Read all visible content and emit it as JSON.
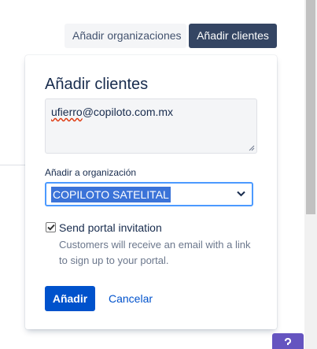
{
  "toolbar": {
    "add_orgs_label": "Añadir organizaciones",
    "add_clients_label": "Añadir clientes"
  },
  "dialog": {
    "title": "Añadir clientes",
    "email_user": "ufierro",
    "email_domain": "@copiloto.com.mx",
    "org_label": "Añadir a organización",
    "org_selected": "COPILOTO SATELITAL",
    "invite_checked": true,
    "invite_label": "Send portal invitation",
    "invite_help": "Customers will receive an email with a link to sign up to your portal.",
    "add_button": "Añadir",
    "cancel_button": "Cancelar"
  },
  "icons": {
    "select_chevron": "chevron-down-icon",
    "checkbox_check": "checkmark-icon",
    "help": "help-icon",
    "resize": "resize-grip-icon"
  },
  "colors": {
    "primary": "#0052cc",
    "dark_button": "#344563",
    "focus_border": "#4c9aff",
    "help_fab": "#6554c0"
  }
}
